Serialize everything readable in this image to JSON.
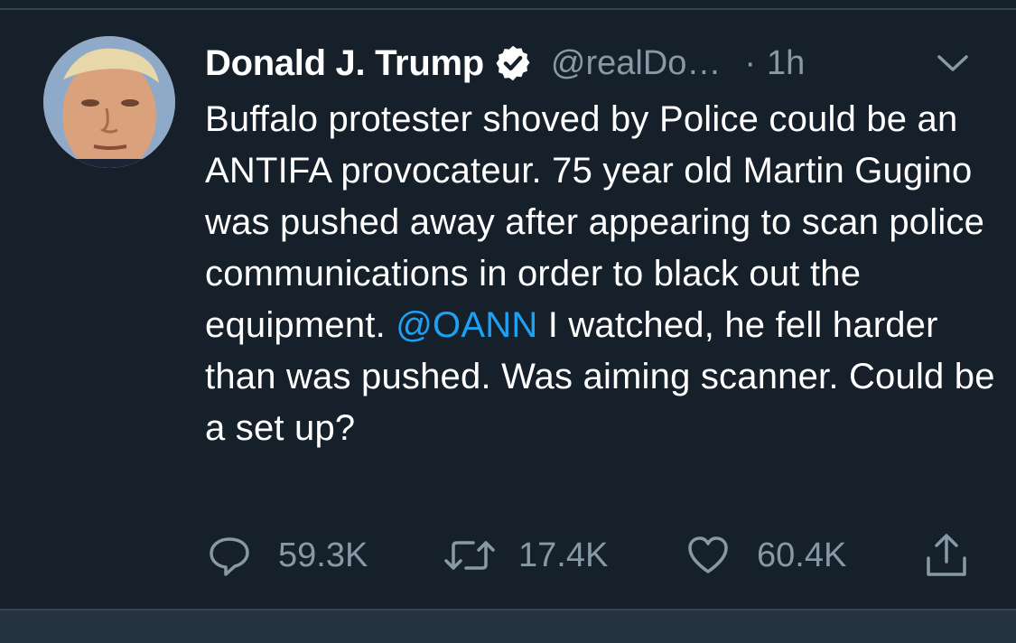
{
  "tweet": {
    "author_name": "Donald J. Trump",
    "handle": "@realDo…",
    "separator": "·",
    "time": "1h",
    "verified": true,
    "text_before_mention": "Buffalo protester shoved by Police could be an ANTIFA provocateur. 75 year old Martin Gugino was pushed away after appearing to scan police communications in order to black out the equipment. ",
    "mention": "@OANN",
    "text_after_mention": "  I watched, he fell harder than was pushed. Was aiming scanner. Could be a set up?"
  },
  "actions": {
    "replies": "59.3K",
    "retweets": "17.4K",
    "likes": "60.4K"
  },
  "icons": {
    "verified": "verified-badge-icon",
    "more": "chevron-down-icon",
    "reply": "reply-icon",
    "retweet": "retweet-icon",
    "like": "heart-icon",
    "share": "share-icon"
  },
  "colors": {
    "background": "#15202b",
    "text": "#ffffff",
    "secondary": "#8899a6",
    "link": "#1da1f2",
    "divider": "#38444d"
  }
}
